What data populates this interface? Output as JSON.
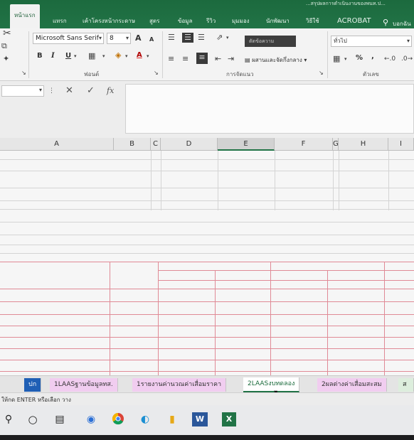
{
  "title_fragment": "...สรุปผลการดำเนินงานของพนท.ป...",
  "tabs": [
    "หน้าแรก",
    "แทรก",
    "เค้าโครงหน้ากระดาษ",
    "สูตร",
    "ข้อมูล",
    "รีวิว",
    "มุมมอง",
    "นักพัฒนา",
    "วิธีใช้",
    "ACROBAT"
  ],
  "tell_me": "บอกฉัน",
  "ribbon": {
    "font_name": "Microsoft Sans Serif",
    "font_size": "8",
    "bold": "B",
    "italic": "I",
    "underline": "U",
    "grow_font": "A",
    "shrink_font": "A",
    "font_group_label": "ฟอนต์",
    "wrap_text": "ตัดข้อความ",
    "merge_center": "ผสานและจัดกึ่งกลาง",
    "align_group_label": "การจัดแนว",
    "number_format": "ทั่วไป",
    "percent": "%",
    "comma": ",",
    "number_group_label": "ตัวเลข"
  },
  "formula_bar": {
    "cancel": "✕",
    "enter": "✓",
    "fx": "fx"
  },
  "columns": [
    "A",
    "B",
    "C",
    "D",
    "E",
    "F",
    "G",
    "H",
    "I"
  ],
  "sheet_tabs": [
    "ปก",
    "1LAASฐานข้อมูลทส.",
    "1รายงานค่านวณค่าเสื่อมราคา",
    "2LAASงบทดลอง",
    "2ผลต่างค่าเสื่อมสะสม",
    "ส"
  ],
  "active_sheet": "2LAASงบทดลอง",
  "status": "ให้กด ENTER หรือเลือก วาง",
  "colors": {
    "accent": "#217346",
    "sheet_blue": "#1f5fb5",
    "sheet_pink": "#f1cdf0",
    "grid_red": "#e08a96"
  },
  "taskbar": {
    "icons": [
      "search-icon",
      "task-view-icon",
      "timeline-icon",
      "edge-legacy-icon",
      "chrome-icon",
      "edge-icon",
      "file-explorer-icon",
      "word-icon",
      "excel-icon"
    ]
  }
}
